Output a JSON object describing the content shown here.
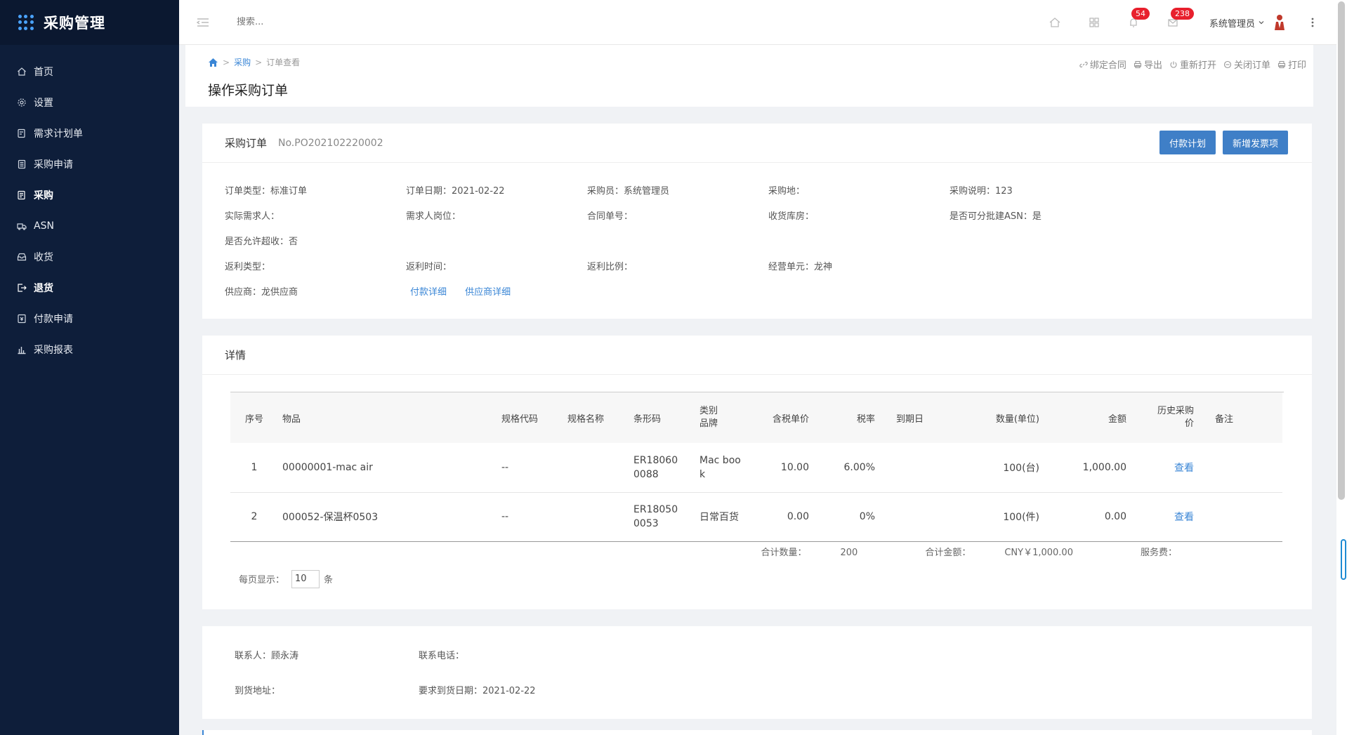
{
  "app": {
    "title": "采购管理"
  },
  "sidebar": {
    "items": [
      {
        "label": "首页",
        "icon": "home-icon"
      },
      {
        "label": "设置",
        "icon": "gear-icon"
      },
      {
        "label": "需求计划单",
        "icon": "document-edit-icon"
      },
      {
        "label": "采购申请",
        "icon": "document-list-icon"
      },
      {
        "label": "采购",
        "icon": "purchase-doc-icon"
      },
      {
        "label": "ASN",
        "icon": "truck-icon"
      },
      {
        "label": "收货",
        "icon": "inbox-icon"
      },
      {
        "label": "退货",
        "icon": "logout-icon"
      },
      {
        "label": "付款申请",
        "icon": "payment-doc-icon"
      },
      {
        "label": "采购报表",
        "icon": "bar-chart-icon"
      }
    ]
  },
  "topbar": {
    "search_placeholder": "搜索...",
    "notifications_count": "54",
    "messages_count": "238",
    "user_name": "系统管理员"
  },
  "breadcrumb": {
    "level1": "采购",
    "level2": "订单查看"
  },
  "page": {
    "title": "操作采购订单",
    "actions": [
      "绑定合同",
      "导出",
      "重新打开",
      "关闭订单",
      "打印"
    ]
  },
  "order": {
    "card_title": "采购订单",
    "order_no": "No.PO202102220002",
    "btn_payment_plan": "付款计划",
    "btn_add_invoice": "新增发票项",
    "fields": {
      "order_type_label": "订单类型：",
      "order_type": "标准订单",
      "order_date_label": "订单日期：",
      "order_date": "2021-02-22",
      "buyer_label": "采购员：",
      "buyer": "系统管理员",
      "purchase_place_label": "采购地：",
      "purchase_place": "",
      "purchase_note_label": "采购说明：",
      "purchase_note": "123",
      "actual_requester_label": "实际需求人：",
      "actual_requester": "",
      "requester_post_label": "需求人岗位：",
      "requester_post": "",
      "contract_no_label": "合同单号：",
      "contract_no": "",
      "warehouse_label": "收货库房：",
      "warehouse": "",
      "batch_asn_label": "是否可分批建ASN：",
      "batch_asn": "是",
      "over_receive_label": "是否允许超收：",
      "over_receive": "否",
      "rebate_type_label": "返利类型：",
      "rebate_type": "",
      "rebate_time_label": "返利时间：",
      "rebate_time": "",
      "rebate_ratio_label": "返利比例：",
      "rebate_ratio": "",
      "business_unit_label": "经营单元：",
      "business_unit": "龙神",
      "supplier_label": "供应商：",
      "supplier": "龙供应商",
      "payment_detail_link": "付款详细",
      "supplier_detail_link": "供应商详细"
    }
  },
  "details": {
    "title": "详情",
    "columns": {
      "seq": "序号",
      "item": "物品",
      "spec_code": "规格代码",
      "spec_name": "规格名称",
      "barcode": "条形码",
      "category_brand": "类别\n品牌",
      "price_tax": "含税单价",
      "tax_rate": "税率",
      "due_date": "到期日",
      "qty_unit": "数量(单位)",
      "amount": "金额",
      "history_price": "历史采购\n价",
      "remark": "备注"
    },
    "rows": [
      {
        "seq": "1",
        "item": "00000001-mac air",
        "spec_code": "--",
        "spec_name": "",
        "barcode": "ER18060\n0088",
        "category_brand": "Mac boo\nk",
        "price_tax": "10.00",
        "tax_rate": "6.00%",
        "due_date": "",
        "qty_unit": "100(台)",
        "amount": "1,000.00",
        "history_price": "查看",
        "remark": ""
      },
      {
        "seq": "2",
        "item": "000052-保温杯0503",
        "spec_code": "--",
        "spec_name": "",
        "barcode": "ER18050\n0053",
        "category_brand": "日常百货",
        "price_tax": "0.00",
        "tax_rate": "0%",
        "due_date": "",
        "qty_unit": "100(件)",
        "amount": "0.00",
        "history_price": "查看",
        "remark": ""
      }
    ],
    "summary": {
      "total_qty_label": "合计数量：",
      "total_qty": "200",
      "total_amount_label": "合计金额：",
      "total_amount": "CNY￥1,000.00",
      "service_fee_label": "服务费：",
      "service_fee": ""
    },
    "pager": {
      "per_page_label": "每页显示：",
      "per_page_value": "10",
      "unit": "条"
    }
  },
  "contact": {
    "contact_person_label": "联系人：",
    "contact_person": "顾永涛",
    "contact_phone_label": "联系电话：",
    "contact_phone": "",
    "address_label": "到货地址：",
    "address": "",
    "required_date_label": "要求到货日期：",
    "required_date": "2021-02-22"
  }
}
